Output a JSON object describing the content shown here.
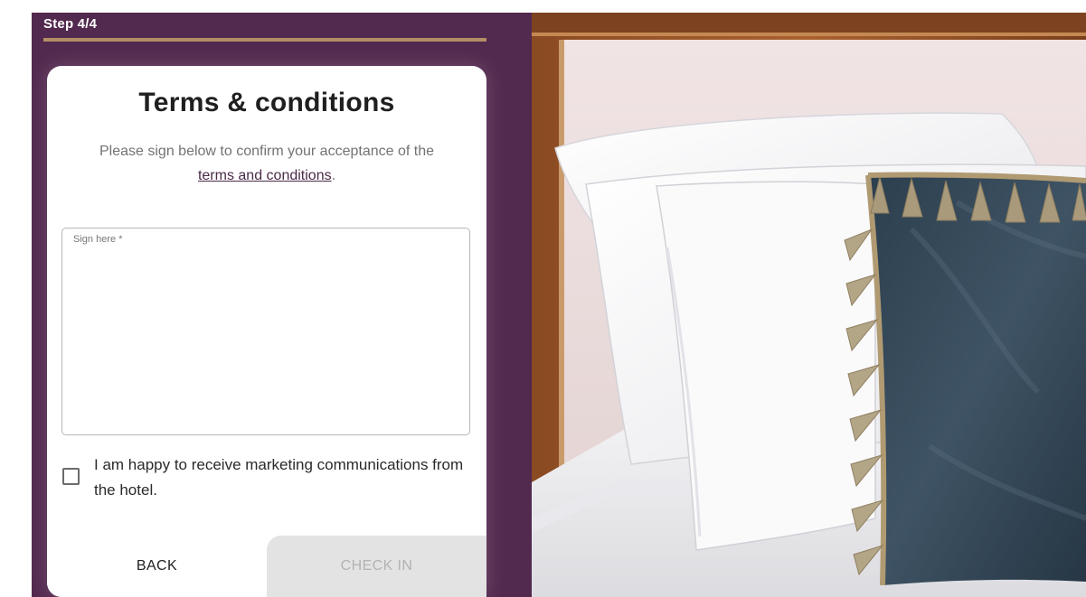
{
  "progress": {
    "step_label": "Step 4/4",
    "fraction": 1.0
  },
  "card": {
    "title": "Terms & conditions",
    "description_prefix": "Please sign below to confirm your acceptance of the",
    "terms_link": "terms and conditions",
    "description_suffix": ".",
    "signature": {
      "legend": "Sign here *",
      "value": ""
    },
    "marketing_checkbox": {
      "label": "I am happy to receive marketing communications from the hotel.",
      "checked": false
    },
    "buttons": {
      "back": "BACK",
      "check_in": "CHECK IN"
    }
  },
  "colors": {
    "panel_bg": "#52294f",
    "progress_bar": "#b38e64",
    "link": "#4a2a47",
    "disabled_button_bg": "#e3e3e3",
    "disabled_button_text": "#b3b3b3"
  },
  "hero_image": {
    "subject": "hotel bed with white pillows and a dark blue velvet tasselled cushion"
  }
}
